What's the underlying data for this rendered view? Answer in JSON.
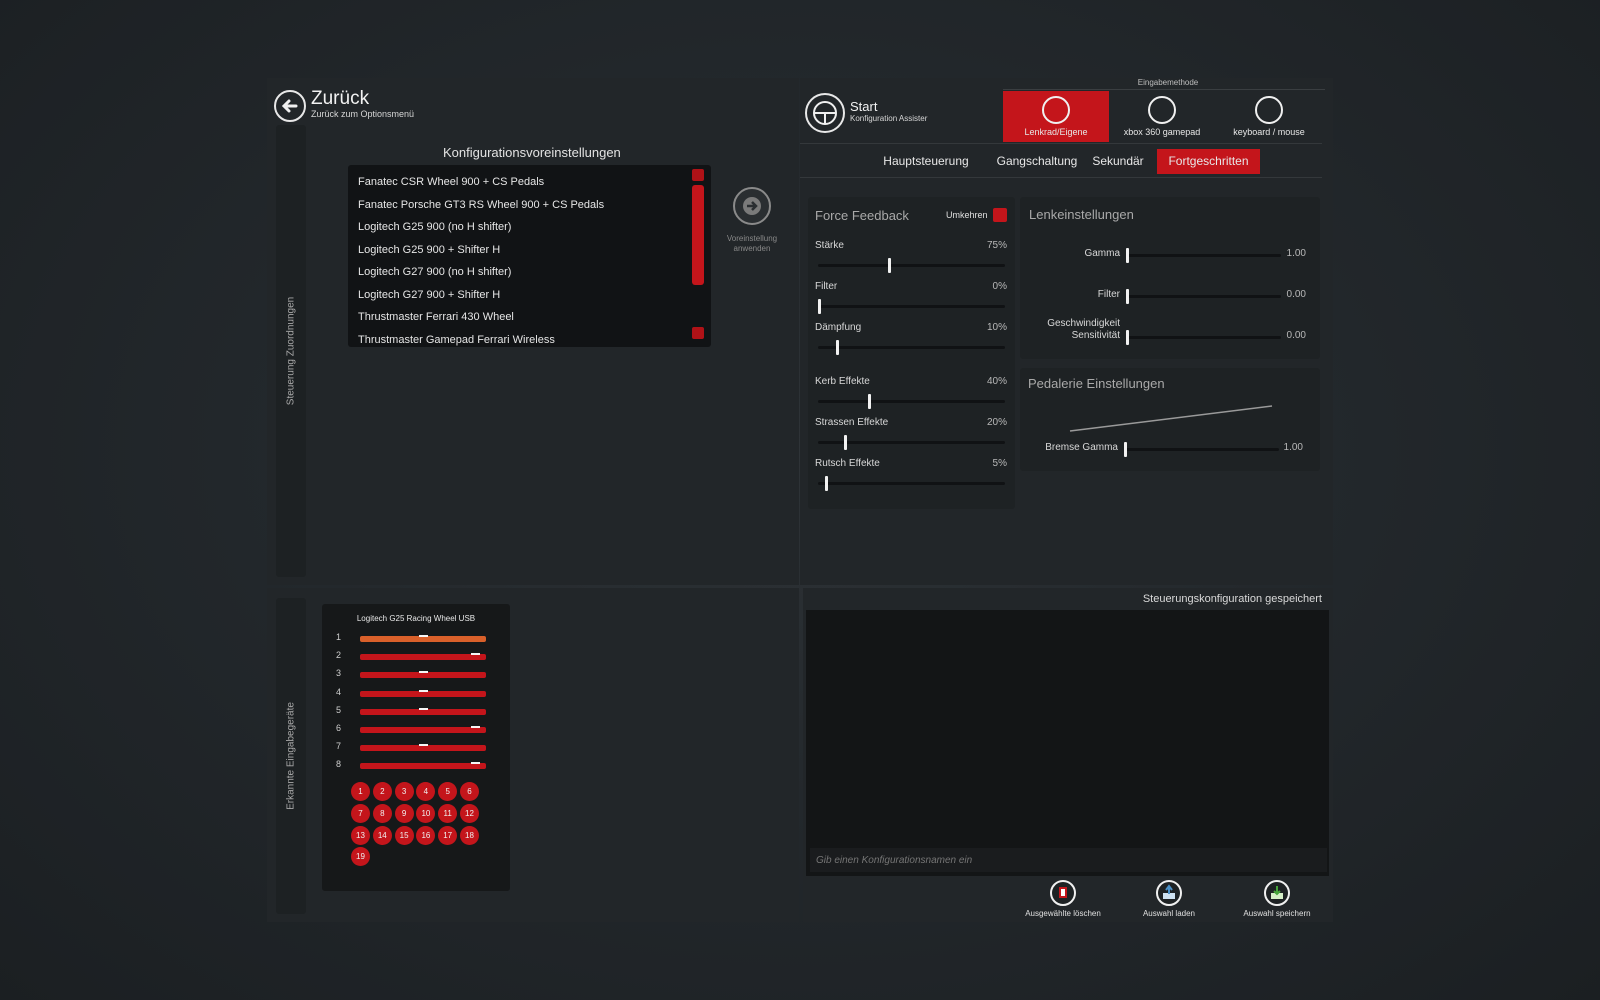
{
  "back": {
    "title": "Zurück",
    "subtitle": "Zurück zum Optionsmenü"
  },
  "start": {
    "title": "Start",
    "subtitle": "Konfiguration Assister"
  },
  "side_tabs": {
    "top": "Steuerung Zuordnungen",
    "bottom": "Erkannte Eingabegeräte"
  },
  "presets": {
    "heading": "Konfigurationsvoreinstellungen",
    "items": [
      "Fanatec CSR Wheel 900 + CS Pedals",
      "Fanatec Porsche GT3 RS Wheel 900 + CS Pedals",
      "Logitech G25 900 (no H shifter)",
      "Logitech G25 900 + Shifter H",
      "Logitech G27 900 (no H shifter)",
      "Logitech G27 900 + Shifter H",
      "Thrustmaster Ferrari 430 Wheel",
      "Thrustmaster Gamepad Ferrari Wireless"
    ],
    "apply_label_1": "Voreinstellung",
    "apply_label_2": "anwenden"
  },
  "input_method": {
    "label": "Eingabemethode",
    "modes": [
      "Lenkrad/Eigene",
      "xbox 360 gamepad",
      "keyboard / mouse"
    ],
    "active_index": 0
  },
  "tabs": {
    "items": [
      "Hauptsteuerung",
      "Gangschaltung",
      "Sekundär",
      "Fortgeschritten"
    ],
    "active_index": 3
  },
  "force_feedback": {
    "title": "Force Feedback",
    "invert_label": "Umkehren",
    "sliders": [
      {
        "label": "Stärke",
        "value_text": "75%",
        "level": 0.38
      },
      {
        "label": "Filter",
        "value_text": "0%",
        "level": 0.0
      },
      {
        "label": "Dämpfung",
        "value_text": "10%",
        "level": 0.1
      },
      {
        "label": "Kerb Effekte",
        "value_text": "40%",
        "level": 0.27
      },
      {
        "label": "Strassen Effekte",
        "value_text": "20%",
        "level": 0.14
      },
      {
        "label": "Rutsch Effekte",
        "value_text": "5%",
        "level": 0.04
      }
    ]
  },
  "steering": {
    "title": "Lenkeinstellungen",
    "sliders": [
      {
        "label": "Gamma",
        "label2": "",
        "value_text": "1.00",
        "level": 0.0
      },
      {
        "label": "Filter",
        "label2": "",
        "value_text": "0.00",
        "level": 0.0
      },
      {
        "label": "Geschwindigkeit",
        "label2": "Sensitivität",
        "value_text": "0.00",
        "level": 0.0
      }
    ]
  },
  "pedals": {
    "title": "Pedalerie Einstellungen",
    "brake_label": "Bremse Gamma",
    "brake_value": "1.00",
    "brake_level": 0.0
  },
  "device": {
    "name": "Logitech G25 Racing Wheel USB",
    "axes": [
      {
        "n": "1",
        "pos": 0.5,
        "color": "orange"
      },
      {
        "n": "2",
        "pos": 0.95,
        "color": "red"
      },
      {
        "n": "3",
        "pos": 0.5,
        "color": "red"
      },
      {
        "n": "4",
        "pos": 0.5,
        "color": "red"
      },
      {
        "n": "5",
        "pos": 0.5,
        "color": "red"
      },
      {
        "n": "6",
        "pos": 0.95,
        "color": "red"
      },
      {
        "n": "7",
        "pos": 0.5,
        "color": "red"
      },
      {
        "n": "8",
        "pos": 0.95,
        "color": "red"
      }
    ],
    "buttons": [
      "1",
      "2",
      "3",
      "4",
      "5",
      "6",
      "7",
      "8",
      "9",
      "10",
      "11",
      "12",
      "13",
      "14",
      "15",
      "16",
      "17",
      "18",
      "19"
    ]
  },
  "config": {
    "status": "Steuerungskonfiguration gespeichert",
    "name_placeholder": "Gib einen Konfigurationsnamen ein",
    "actions": [
      "Ausgewählte löschen",
      "Auswahl laden",
      "Auswahl speichern"
    ]
  },
  "colors": {
    "accent": "#c4151b",
    "orange": "#d9602a",
    "panel": "#222629"
  }
}
